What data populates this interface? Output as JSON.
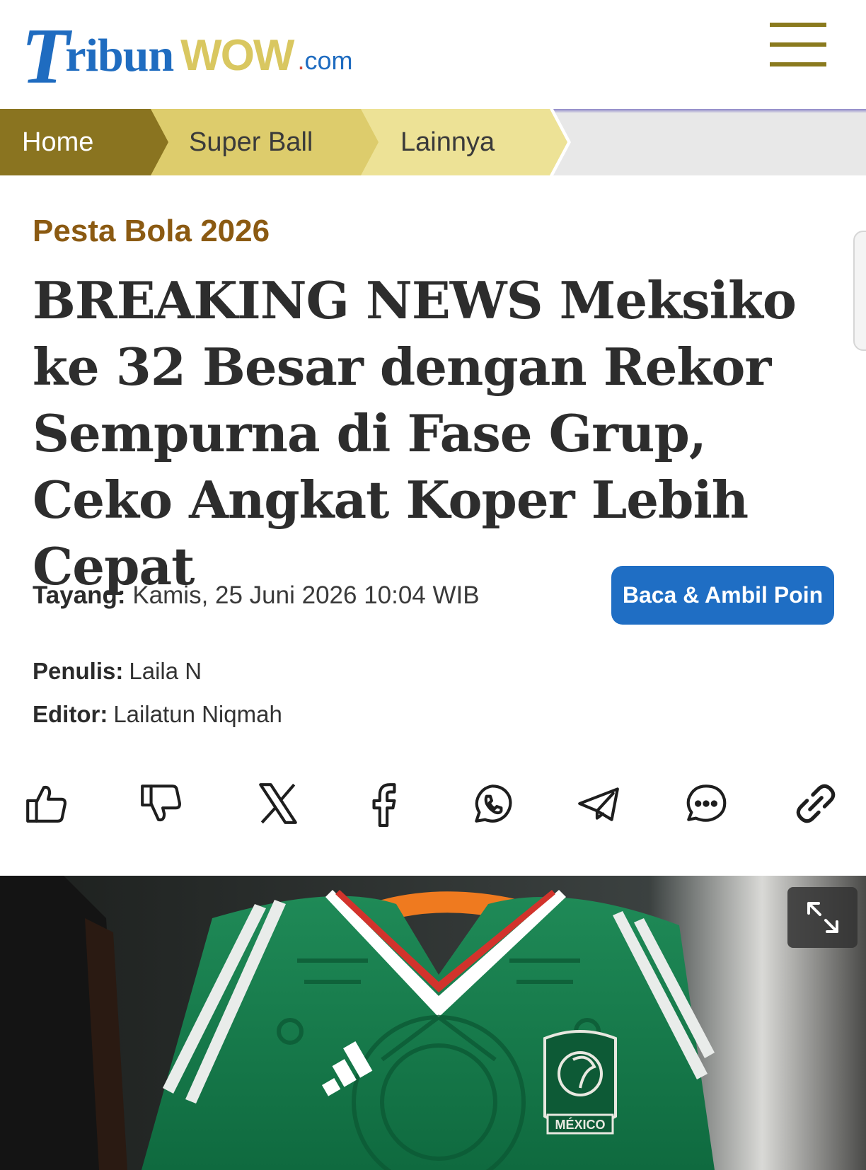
{
  "header": {
    "logo_t": "T",
    "logo_ribun": "ribun",
    "logo_wow": "WOW",
    "logo_dot": ".",
    "logo_com": "com",
    "menu_icon": "hamburger-icon"
  },
  "breadcrumb": {
    "items": [
      {
        "label": "Home"
      },
      {
        "label": "Super Ball"
      },
      {
        "label": "Lainnya"
      }
    ]
  },
  "article": {
    "kicker": "Pesta Bola 2026",
    "headline": "BREAKING NEWS Meksiko ke 32 Besar dengan Rekor Sempurna di Fase Grup, Ceko Angkat Koper Lebih Cepat",
    "tayang_label": "Tayang:",
    "tayang_value": "Kamis, 25 Juni 2026 10:04 WIB",
    "points_button": "Baca & Ambil Poin",
    "penulis_label": "Penulis:",
    "penulis_value": "Laila N",
    "editor_label": "Editor:",
    "editor_value": "Lailatun Niqmah"
  },
  "share_icons": [
    "thumbs-up-icon",
    "thumbs-down-icon",
    "x-icon",
    "facebook-icon",
    "whatsapp-icon",
    "telegram-icon",
    "comment-icon",
    "link-icon"
  ],
  "photo": {
    "jersey_crest_text": "MÉXICO",
    "expand_icon": "expand-icon"
  },
  "colors": {
    "brand_blue": "#1f6cc0",
    "brand_gold": "#d9c760",
    "kicker": "#8b5a12",
    "crumb_home": "#8a7420",
    "crumb_super": "#ddcc6c",
    "crumb_lainnya": "#ede296",
    "button": "#1f6ec4"
  }
}
